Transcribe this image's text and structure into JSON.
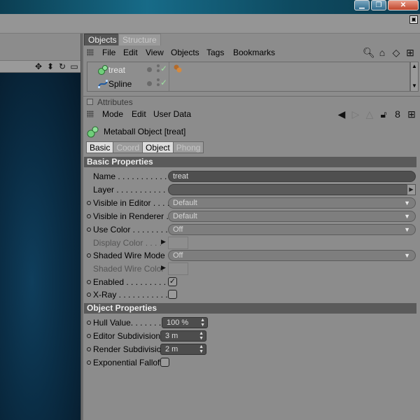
{
  "window": {
    "minimize_glyph": "▁",
    "maximize_glyph": "❐",
    "close_glyph": "✕"
  },
  "viewport": {
    "icons": [
      "move-icon",
      "drag-icon",
      "rotate-icon",
      "maximize-icon"
    ]
  },
  "object_manager": {
    "tabs": [
      {
        "label": "Objects",
        "active": true
      },
      {
        "label": "Structure",
        "active": false
      }
    ],
    "menu": [
      "File",
      "Edit",
      "View",
      "Objects",
      "Tags",
      "Bookmarks"
    ],
    "tools": [
      "search-icon",
      "home-icon",
      "eye-icon",
      "new-panel-icon"
    ],
    "objects": [
      {
        "name": "treat",
        "icon": "metaball-icon",
        "selected": true
      },
      {
        "name": "Spline",
        "icon": "spline-icon",
        "selected": false
      }
    ]
  },
  "attributes": {
    "tab_label": "Attributes",
    "menu": [
      "Mode",
      "Edit",
      "User Data"
    ],
    "tools": [
      "back-arrow-icon",
      "forward-arrow-icon",
      "up-arrow-icon",
      "lock-icon",
      "link-icon",
      "new-panel-icon"
    ],
    "object_title": "Metaball Object [treat]",
    "sub_tabs": [
      {
        "label": "Basic",
        "active": true
      },
      {
        "label": "Coord",
        "active": false
      },
      {
        "label": "Object",
        "active": true
      },
      {
        "label": "Phong",
        "active": false
      }
    ],
    "basic": {
      "section_title": "Basic Properties",
      "name_label": "Name . . . . . . . . . . . .",
      "name_value": "treat",
      "layer_label": "Layer . . . . . . . . . . . .",
      "layer_value": "",
      "visible_editor_label": "Visible in Editor . . . . .",
      "visible_editor_value": "Default",
      "visible_renderer_label": "Visible in Renderer . .",
      "visible_renderer_value": "Default",
      "use_color_label": "Use Color . . . . . . . . .",
      "use_color_value": "Off",
      "display_color_label": "Display Color  . . . .",
      "shaded_wire_mode_label": "Shaded Wire Mode",
      "shaded_wire_mode_value": "Off",
      "shaded_wire_color_label": "Shaded Wire Color",
      "enabled_label": "Enabled . . . . . . . . . .",
      "enabled_checked": true,
      "xray_label": "X-Ray . . . . . . . . . . . .",
      "xray_checked": false
    },
    "object": {
      "section_title": "Object Properties",
      "hull_label": "Hull Value. . . . . . . .",
      "hull_value": "100 %",
      "editor_sub_label": "Editor Subdivision",
      "editor_sub_value": "3 m",
      "render_sub_label": "Render Subdivision",
      "render_sub_value": "2 m",
      "exp_falloff_label": "Exponential Falloff",
      "exp_falloff_checked": false
    }
  }
}
